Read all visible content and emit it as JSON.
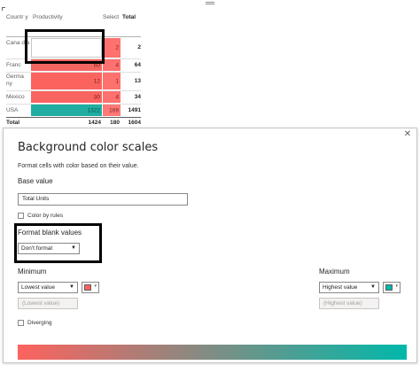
{
  "matrix": {
    "headers": {
      "country": "Countr y",
      "productivity": "Productivity",
      "select": "Select",
      "total": "Total"
    },
    "rows": [
      {
        "country": "Cana d a",
        "productivity_fraction": 0.0,
        "productivity": "",
        "select": "2",
        "total": "2"
      },
      {
        "country": "Franc",
        "productivity_fraction": 0.04,
        "productivity": "60",
        "select": "4",
        "total": "64"
      },
      {
        "country": "Germa ny",
        "productivity_fraction": 0.008,
        "productivity": "12",
        "select": "1",
        "total": "13"
      },
      {
        "country": "Mexico",
        "productivity_fraction": 0.02,
        "productivity": "30",
        "select": "4",
        "total": "34"
      },
      {
        "country": "USA",
        "productivity_fraction": 0.88,
        "productivity": "1322",
        "select": "169",
        "total": "1491"
      }
    ],
    "totals": {
      "label": "Total",
      "productivity": "1424",
      "select": "180",
      "total": "1604"
    }
  },
  "dialog": {
    "title": "Background color scales",
    "subtitle": "Format cells with color based on their value.",
    "base_value_label": "Base value",
    "base_value": "Total Units",
    "color_by_rules": "Color by rules",
    "blank_values_label": "Format blank values",
    "blank_values_selected": "Don't format",
    "minimum_label": "Minimum",
    "minimum_selected": "Lowest value",
    "minimum_placeholder": "(Lowest value)",
    "maximum_label": "Maximum",
    "maximum_selected": "Highest value",
    "maximum_placeholder": "(Highest value)",
    "diverging": "Diverging",
    "close_glyph": "✕"
  },
  "colors": {
    "min": "#fd625e",
    "max": "#01b8aa"
  }
}
